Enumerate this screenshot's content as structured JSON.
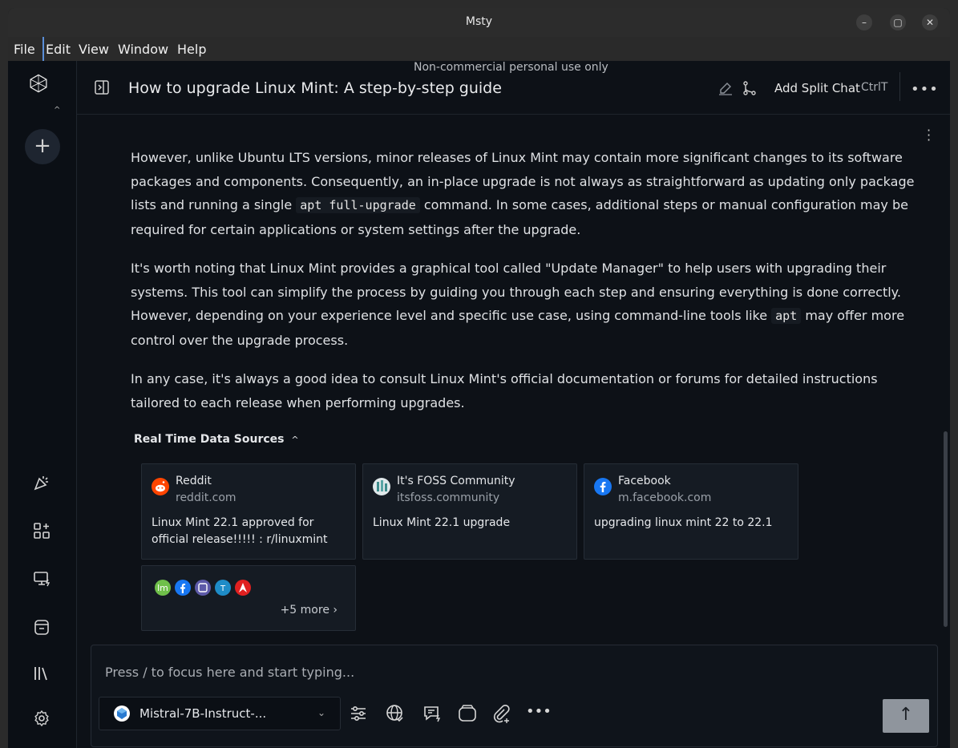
{
  "window": {
    "title": "Msty"
  },
  "menubar": {
    "items": [
      "File",
      "Edit",
      "View",
      "Window",
      "Help"
    ]
  },
  "header": {
    "notice": "Non-commercial personal use only",
    "chat_title": "How to upgrade Linux Mint: A step-by-step guide",
    "split_label": "Add Split Chat",
    "split_shortcut": "CtrlT"
  },
  "content": {
    "paragraphs": [
      {
        "before": "However, unlike Ubuntu LTS versions, minor releases of Linux Mint may contain more significant changes to its software packages and components. Consequently, an in-place upgrade is not always as straightforward as updating only package lists and running a single ",
        "code": "apt full-upgrade",
        "after": " command. In some cases, additional steps or manual configuration may be required for certain applications or system settings after the upgrade."
      },
      {
        "before": "It's worth noting that Linux Mint provides a graphical tool called \"Update Manager\" to help users with upgrading their systems. This tool can simplify the process by guiding you through each step and ensuring everything is done correctly. However, depending on your experience level and specific use case, using command-line tools like ",
        "code": "apt",
        "after": " may offer more control over the upgrade process."
      },
      {
        "before": "In any case, it's always a good idea to consult Linux Mint's official documentation or forums for detailed instructions tailored to each release when performing upgrades.",
        "code": "",
        "after": ""
      }
    ],
    "sources_title": "Real Time Data Sources",
    "sources": [
      {
        "site": "Reddit",
        "domain": "reddit.com",
        "snippet": "Linux Mint 22.1 approved for official release!!!!! : r/linuxmint",
        "icon": "reddit-icon"
      },
      {
        "site": "It's FOSS Community",
        "domain": "itsfoss.community",
        "snippet": "Linux Mint 22.1 upgrade",
        "icon": "itsfoss-icon"
      },
      {
        "site": "Facebook",
        "domain": "m.facebook.com",
        "snippet": "upgrading linux mint 22 to 22.1",
        "icon": "facebook-icon"
      }
    ],
    "more_sources_label": "+5 more"
  },
  "composer": {
    "placeholder": "Press / to focus here and start typing...",
    "model": "Mistral-7B-Instruct-..."
  },
  "colors": {
    "background": "#0d1117",
    "card": "#151b23",
    "reddit": "#ff4500",
    "facebook": "#1877f2",
    "send_button": "#8f959d"
  }
}
